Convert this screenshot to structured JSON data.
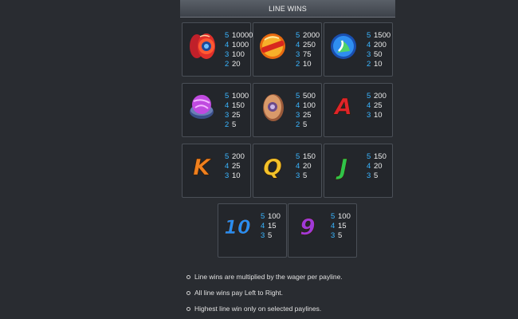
{
  "title": "LINE WINS",
  "symbols": [
    {
      "name": "red-yoyo",
      "pays": [
        [
          "5",
          "10000"
        ],
        [
          "4",
          "1000"
        ],
        [
          "3",
          "100"
        ],
        [
          "2",
          "20"
        ]
      ]
    },
    {
      "name": "orange-yoyo",
      "pays": [
        [
          "5",
          "2000"
        ],
        [
          "4",
          "250"
        ],
        [
          "3",
          "75"
        ],
        [
          "2",
          "10"
        ]
      ]
    },
    {
      "name": "blue-yoyo",
      "pays": [
        [
          "5",
          "1500"
        ],
        [
          "4",
          "200"
        ],
        [
          "3",
          "50"
        ],
        [
          "2",
          "10"
        ]
      ]
    },
    {
      "name": "purple-yoyo",
      "pays": [
        [
          "5",
          "1000"
        ],
        [
          "4",
          "150"
        ],
        [
          "3",
          "25"
        ],
        [
          "2",
          "5"
        ]
      ]
    },
    {
      "name": "copper-yoyo",
      "pays": [
        [
          "5",
          "500"
        ],
        [
          "4",
          "100"
        ],
        [
          "3",
          "25"
        ],
        [
          "2",
          "5"
        ]
      ]
    },
    {
      "name": "A",
      "pays": [
        [
          "5",
          "200"
        ],
        [
          "4",
          "25"
        ],
        [
          "3",
          "10"
        ]
      ]
    },
    {
      "name": "K",
      "pays": [
        [
          "5",
          "200"
        ],
        [
          "4",
          "25"
        ],
        [
          "3",
          "10"
        ]
      ]
    },
    {
      "name": "Q",
      "pays": [
        [
          "5",
          "150"
        ],
        [
          "4",
          "20"
        ],
        [
          "3",
          "5"
        ]
      ]
    },
    {
      "name": "J",
      "pays": [
        [
          "5",
          "150"
        ],
        [
          "4",
          "20"
        ],
        [
          "3",
          "5"
        ]
      ]
    },
    {
      "name": "10",
      "pays": [
        [
          "5",
          "100"
        ],
        [
          "4",
          "15"
        ],
        [
          "3",
          "5"
        ]
      ]
    },
    {
      "name": "9",
      "pays": [
        [
          "5",
          "100"
        ],
        [
          "4",
          "15"
        ],
        [
          "3",
          "5"
        ]
      ]
    }
  ],
  "letter_colors": {
    "A": "#e0242a",
    "K": "#f0801e",
    "Q": "#f3c22a",
    "J": "#2fc44a",
    "10": "#2a8df0",
    "9": "#a03ad8"
  },
  "notes": [
    "Line wins are multiplied by the wager per payline.",
    "All line wins pay Left to Right.",
    "Highest line win only on selected paylines."
  ]
}
